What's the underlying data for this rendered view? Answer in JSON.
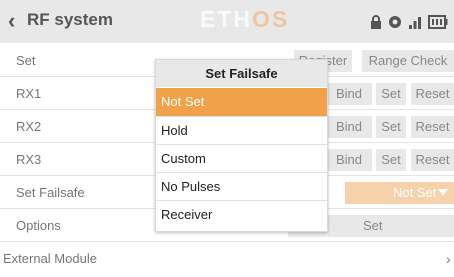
{
  "header": {
    "title": "RF system",
    "logo_main": "ETH",
    "logo_accent": "OS",
    "icons": [
      "lock-icon",
      "usb-icon",
      "signal-icon",
      "battery-icon"
    ]
  },
  "rows": {
    "set": {
      "label": "Set",
      "register": "Register",
      "range_check": "Range Check"
    },
    "rx1": {
      "label": "RX1",
      "bind": "Bind",
      "set": "Set",
      "reset": "Reset"
    },
    "rx2": {
      "label": "RX2",
      "bind": "Bind",
      "set": "Set",
      "reset": "Reset"
    },
    "rx3": {
      "label": "RX3",
      "bind": "Bind",
      "set": "Set",
      "reset": "Reset"
    },
    "failsafe": {
      "label": "Set Failsafe",
      "value": "Not Set"
    },
    "options": {
      "label": "Options",
      "button": "Set"
    },
    "external": {
      "label": "External Module"
    }
  },
  "popup": {
    "title": "Set Failsafe",
    "options": [
      "Not Set",
      "Hold",
      "Custom",
      "No Pulses",
      "Receiver"
    ],
    "selected": "Not Set"
  },
  "colors": {
    "accent": "#f0a14a",
    "accent_light": "#f6d2ac",
    "header_bg": "#e8e8e8"
  }
}
